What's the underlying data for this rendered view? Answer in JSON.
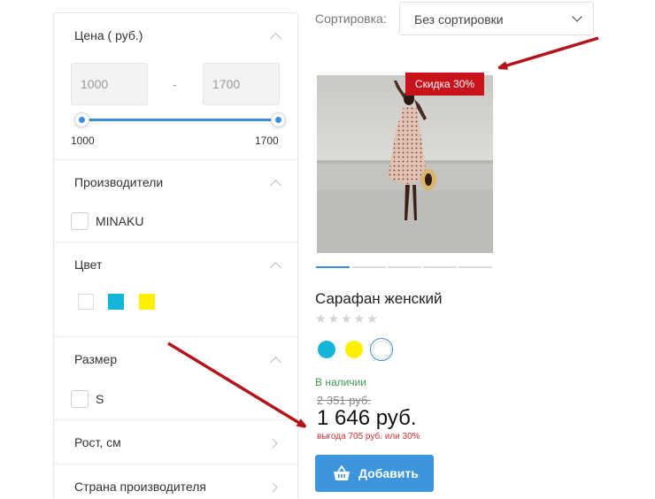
{
  "filters": {
    "price": {
      "title": "Цена ( руб.)",
      "min_value": "1000",
      "max_value": "1700",
      "separator": "-",
      "range_min_label": "1000",
      "range_max_label": "1700"
    },
    "manufacturers": {
      "title": "Производители",
      "options": [
        "MINAKU"
      ]
    },
    "color": {
      "title": "Цвет",
      "swatches": [
        "#ffffff",
        "#13b5d8",
        "#fff100"
      ]
    },
    "size": {
      "title": "Размер",
      "options": [
        "S"
      ]
    },
    "height": {
      "title": "Рост, см"
    },
    "country": {
      "title": "Страна производителя"
    }
  },
  "sort": {
    "label": "Сортировка:",
    "selected": "Без сортировки"
  },
  "product": {
    "badge": "Скидка 30%",
    "name": "Сарафан женский",
    "rating": {
      "stars_filled": 0,
      "stars_total": 5,
      "glyphs": "★★★★★"
    },
    "colors": [
      "#13b5d8",
      "#fff100",
      "#ffffff"
    ],
    "selected_color_index": 2,
    "stock": "В наличии",
    "old_price": "2 351 руб.",
    "price": "1 646 руб.",
    "benefit": "выгода 705 руб. или 30%",
    "add_button": "Добавить",
    "gallery_count": 5,
    "gallery_active_index": 0
  },
  "accent_color": "#3a8fd6",
  "badge_color": "#c9121c",
  "annotation_arrow_color": "#b3141b"
}
